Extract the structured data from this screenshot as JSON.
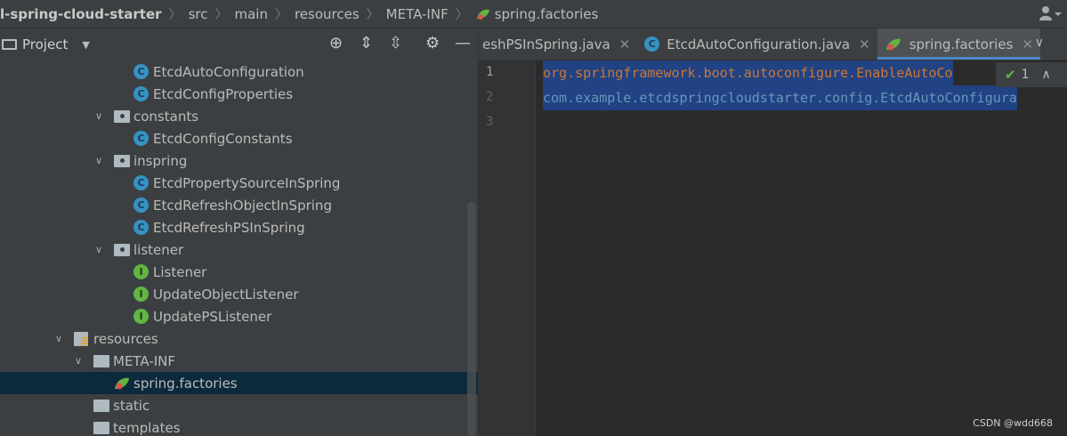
{
  "breadcrumb": {
    "items": [
      "l-spring-cloud-starter",
      "src",
      "main",
      "resources",
      "META-INF",
      "spring.factories"
    ],
    "user_icon": "user-icon"
  },
  "project_panel": {
    "title": "Project",
    "tools": [
      "locate-icon",
      "expand-all-icon",
      "collapse-all-icon",
      "gear-icon",
      "minimize-icon"
    ]
  },
  "tree": [
    {
      "label": "EtcdAutoConfiguration",
      "icon": "class-icon",
      "indent": 4
    },
    {
      "label": "EtcdConfigProperties",
      "icon": "class-icon",
      "indent": 4
    },
    {
      "label": "constants",
      "icon": "package-icon",
      "indent": 3,
      "expanded": true
    },
    {
      "label": "EtcdConfigConstants",
      "icon": "class-icon",
      "indent": 4
    },
    {
      "label": "inspring",
      "icon": "package-icon",
      "indent": 3,
      "expanded": true
    },
    {
      "label": "EtcdPropertySourceInSpring",
      "icon": "class-icon",
      "indent": 4
    },
    {
      "label": "EtcdRefreshObjectInSpring",
      "icon": "class-icon",
      "indent": 4
    },
    {
      "label": "EtcdRefreshPSInSpring",
      "icon": "class-icon",
      "indent": 4
    },
    {
      "label": "listener",
      "icon": "package-icon",
      "indent": 3,
      "expanded": true
    },
    {
      "label": "Listener",
      "icon": "interface-icon",
      "indent": 4
    },
    {
      "label": "UpdateObjectListener",
      "icon": "interface-icon",
      "indent": 4
    },
    {
      "label": "UpdatePSListener",
      "icon": "interface-icon",
      "indent": 4
    },
    {
      "label": "resources",
      "icon": "resources-folder-icon",
      "indent": 1,
      "expanded": true
    },
    {
      "label": "META-INF",
      "icon": "folder-icon",
      "indent": 2,
      "expanded": true
    },
    {
      "label": "spring.factories",
      "icon": "spring-leaf-icon",
      "indent": 3,
      "selected": true
    },
    {
      "label": "static",
      "icon": "folder-icon",
      "indent": 2
    },
    {
      "label": "templates",
      "icon": "folder-icon",
      "indent": 2
    }
  ],
  "tabs": [
    {
      "label": "eshPSInSpring.java",
      "icon": "",
      "active": false
    },
    {
      "label": "EtcdAutoConfiguration.java",
      "icon": "class-icon",
      "active": false
    },
    {
      "label": "spring.factories",
      "icon": "spring-leaf-icon",
      "active": true
    }
  ],
  "tabs_more_icon": "chevron-down-icon",
  "editor": {
    "line_numbers": [
      "1",
      "2",
      "3"
    ],
    "lines": [
      {
        "text": "org.springframework.boot.autoconfigure.EnableAutoCo",
        "kind": "key",
        "highlight": true
      },
      {
        "text": "com.example.etcdspringcloudstarter.config.EtcdAutoConfigura",
        "kind": "val",
        "highlight": true
      },
      {
        "text": "",
        "kind": "val",
        "highlight": false
      }
    ],
    "inspection_count": "1"
  },
  "watermark": "CSDN @wdd668",
  "colors": {
    "selection": "#214283",
    "tree_selection": "#0d293e",
    "active_tab_underline": "#4a88c7",
    "keyword_orange": "#cc7832",
    "value_blue": "#6897bb"
  }
}
